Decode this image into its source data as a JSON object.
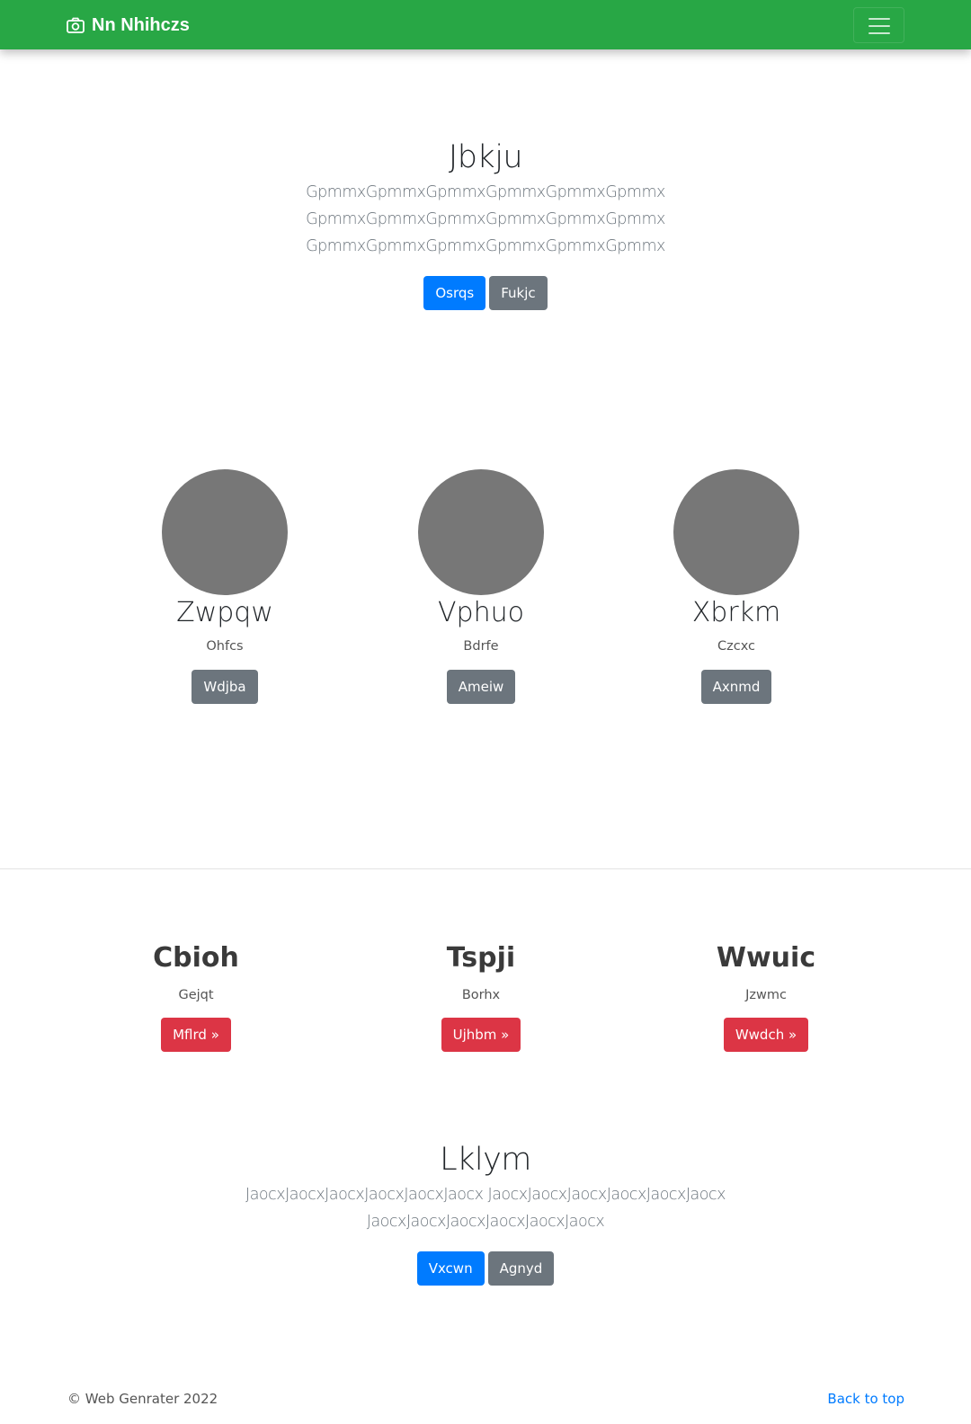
{
  "navbar": {
    "brand_icon": "camera-icon",
    "brand_text": "Nn Nhihczs",
    "toggler_icon": "hamburger-menu-icon",
    "color": "#28a745"
  },
  "hero": {
    "title": "Jbkju",
    "lines": [
      "GpmmxGpmmxGpmmxGpmmxGpmmxGpmmx",
      "GpmmxGpmmxGpmmxGpmmxGpmmxGpmmx",
      "GpmmxGpmmxGpmmxGpmmxGpmmxGpmmx"
    ],
    "primary_button": "Osrqs",
    "secondary_button": "Fukjc"
  },
  "people": [
    {
      "name": "Zwpqw",
      "sub": "Ohfcs",
      "button": "Wdjba"
    },
    {
      "name": "Vphuo",
      "sub": "Bdrfe",
      "button": "Ameiw"
    },
    {
      "name": "Xbrkm",
      "sub": "Czcxc",
      "button": "Axnmd"
    }
  ],
  "features": [
    {
      "title": "Cbioh",
      "sub": "Gejqt",
      "button": "Mflrd »"
    },
    {
      "title": "Tspji",
      "sub": "Borhx",
      "button": "Ujhbm »"
    },
    {
      "title": "Wwuic",
      "sub": "Jzwmc",
      "button": "Wwdch »"
    }
  ],
  "cta": {
    "title": "Lklym",
    "lines": [
      "JaocxJaocxJaocxJaocxJaocxJaocx JaocxJaocxJaocxJaocxJaocxJaocx",
      "JaocxJaocxJaocxJaocxJaocxJaocx"
    ],
    "primary_button": "Vxcwn",
    "secondary_button": "Agnyd"
  },
  "footer": {
    "copyright": "© Web Genrater 2022",
    "back_to_top": "Back to top"
  }
}
